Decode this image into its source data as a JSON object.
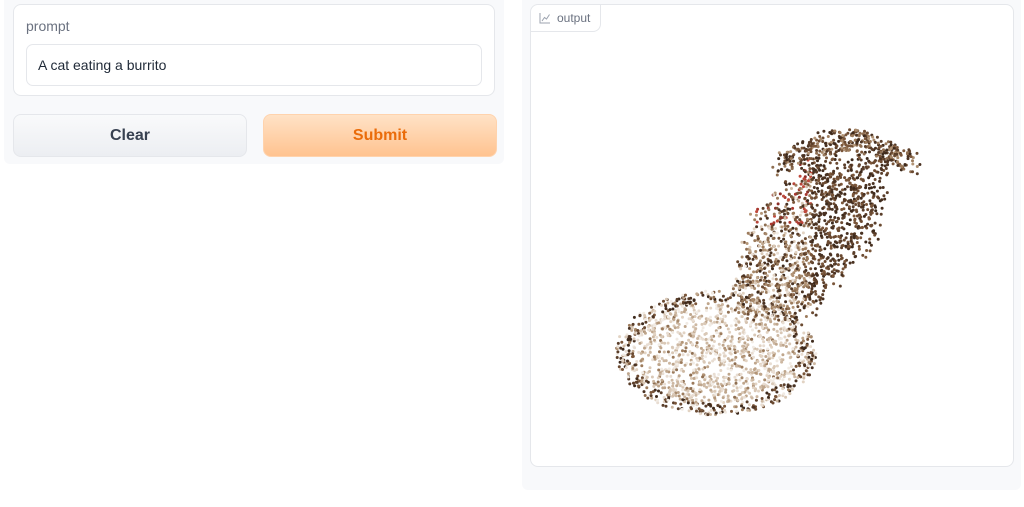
{
  "prompt": {
    "label": "prompt",
    "value": "A cat eating a burrito"
  },
  "buttons": {
    "clear_label": "Clear",
    "submit_label": "Submit"
  },
  "output": {
    "label": "output",
    "icon": "chart-icon"
  },
  "colors": {
    "submit_text": "#ea6c0a",
    "submit_bg": "#ffc390",
    "panel_bg": "#f8f9fb",
    "border": "#e5e7eb"
  }
}
